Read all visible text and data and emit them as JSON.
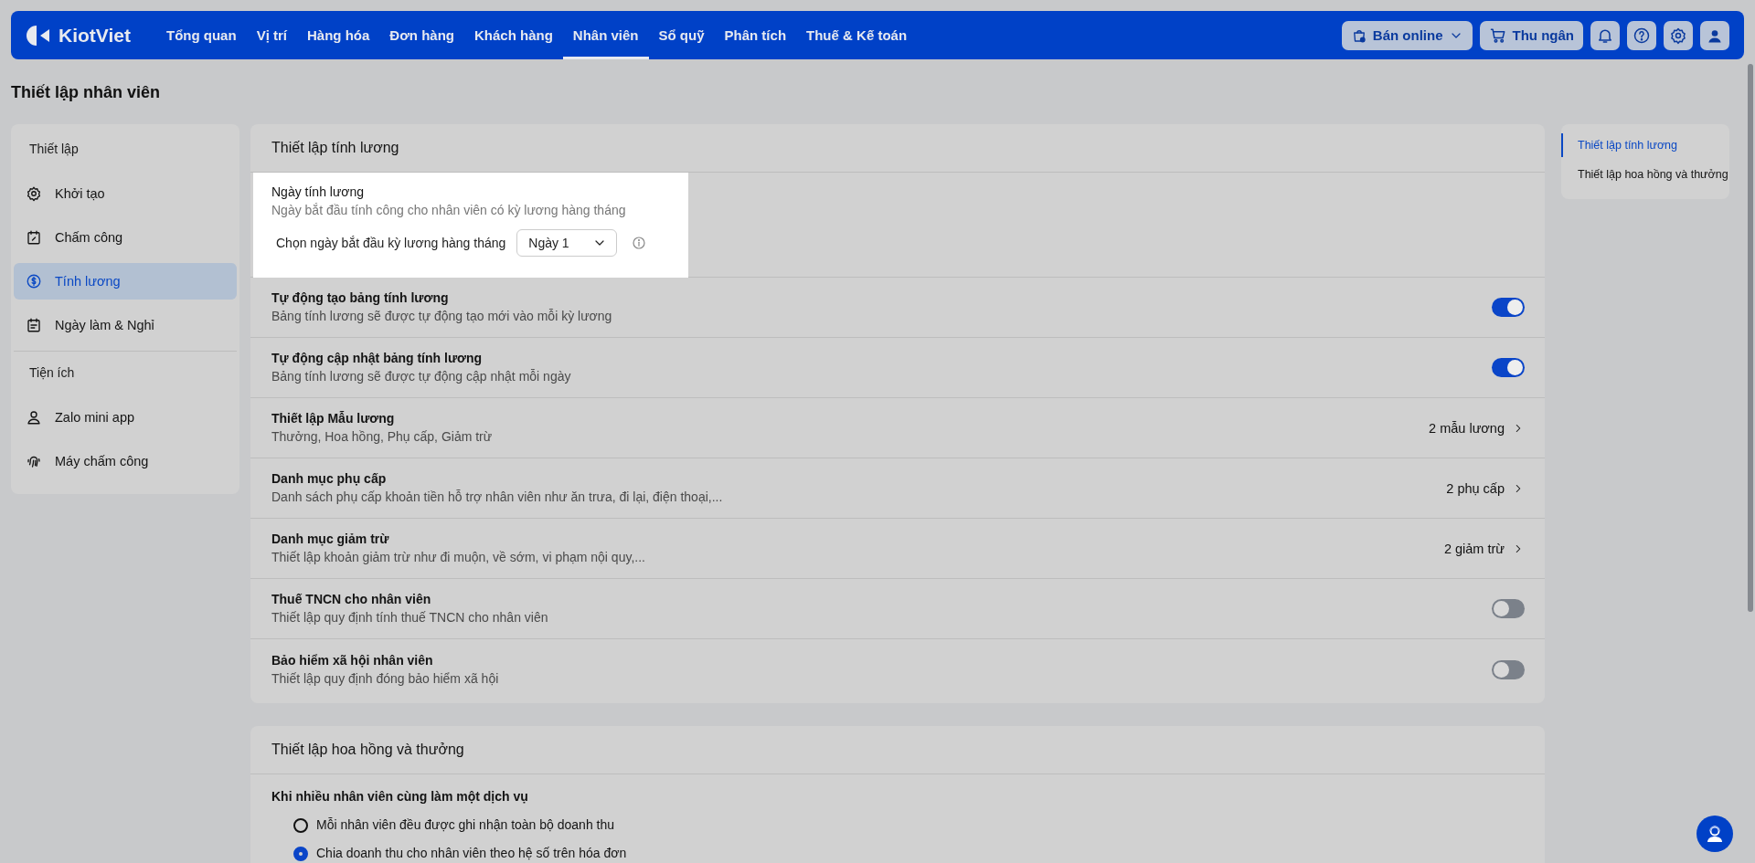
{
  "header": {
    "logo": "KiotViet",
    "nav": [
      {
        "label": "Tổng quan",
        "selected": false
      },
      {
        "label": "Vị trí",
        "selected": false
      },
      {
        "label": "Hàng hóa",
        "selected": false
      },
      {
        "label": "Đơn hàng",
        "selected": false
      },
      {
        "label": "Khách hàng",
        "selected": false
      },
      {
        "label": "Nhân viên",
        "selected": true
      },
      {
        "label": "Sổ quỹ",
        "selected": false
      },
      {
        "label": "Phân tích",
        "selected": false
      },
      {
        "label": "Thuế & Kế toán",
        "selected": false
      }
    ],
    "actions": [
      {
        "label": "Bán online",
        "kind": "dropdown"
      },
      {
        "label": "Thu ngân",
        "kind": "button"
      }
    ]
  },
  "page_title": "Thiết lập nhân viên",
  "sidebar": {
    "groups": [
      {
        "heading": "Thiết lập",
        "items": [
          {
            "label": "Khởi tạo",
            "selected": false
          },
          {
            "label": "Chấm công",
            "selected": false
          },
          {
            "label": "Tính lương",
            "selected": true
          },
          {
            "label": "Ngày làm & Nghỉ",
            "selected": false
          }
        ]
      },
      {
        "heading": "Tiện ích",
        "items": [
          {
            "label": "Zalo mini app",
            "selected": false
          },
          {
            "label": "Máy chấm công",
            "selected": false
          }
        ]
      }
    ]
  },
  "sections": [
    {
      "title": "Thiết lập tính lương",
      "rows": [
        {
          "kind": "select",
          "highlighted": true,
          "title": "Ngày tính lương",
          "description": "Ngày bắt đầu tính công cho nhân viên có kỳ lương hàng tháng",
          "field_label": "Chọn ngày bắt đầu kỳ lương hàng tháng",
          "value": "Ngày 1"
        },
        {
          "kind": "toggle",
          "highlighted": false,
          "title": "Tự động tạo bảng tính lương",
          "description": "Bảng tính lương sẽ được tự động tạo mới vào mỗi kỳ lương",
          "on": true
        },
        {
          "kind": "toggle",
          "highlighted": false,
          "title": "Tự động cập nhật bảng tính lương",
          "description": "Bảng tính lương sẽ được tự động cập nhật mỗi ngày",
          "on": true
        },
        {
          "kind": "link",
          "highlighted": false,
          "title": "Thiết lập Mẫu lương",
          "description": "Thưởng, Hoa hồng, Phụ cấp, Giảm trừ",
          "value": "2 mẫu lương"
        },
        {
          "kind": "link",
          "highlighted": false,
          "title": "Danh mục phụ cấp",
          "description": "Danh sách phụ cấp khoản tiền hỗ trợ nhân viên như ăn trưa, đi lại, điện thoại,...",
          "value": "2 phụ cấp"
        },
        {
          "kind": "link",
          "highlighted": false,
          "title": "Danh mục giảm trừ",
          "description": "Thiết lập khoản giảm trừ như đi muộn, về sớm, vi phạm nội quy,...",
          "value": "2 giảm trừ"
        },
        {
          "kind": "toggle",
          "highlighted": false,
          "title": "Thuế TNCN cho nhân viên",
          "description": "Thiết lập quy định tính thuế TNCN cho nhân viên",
          "on": false
        },
        {
          "kind": "toggle",
          "highlighted": false,
          "title": "Bảo hiểm xã hội nhân viên",
          "description": "Thiết lập quy định đóng bảo hiểm xã hội",
          "on": false
        }
      ]
    },
    {
      "title": "Thiết lập hoa hồng và thưởng",
      "rows": [
        {
          "kind": "radio_group",
          "highlighted": false,
          "title": "Khi nhiều nhân viên cùng làm một dịch vụ",
          "options": [
            {
              "label": "Mỗi nhân viên đều được ghi nhận toàn bộ doanh thu",
              "selected": false
            },
            {
              "label": "Chia doanh thu cho nhân viên theo hệ số trên hóa đơn",
              "selected": true
            }
          ]
        }
      ]
    }
  ],
  "toc": [
    {
      "label": "Thiết lập tính lương",
      "selected": true
    },
    {
      "label": "Thiết lập hoa hồng và thưởng",
      "selected": false
    }
  ]
}
